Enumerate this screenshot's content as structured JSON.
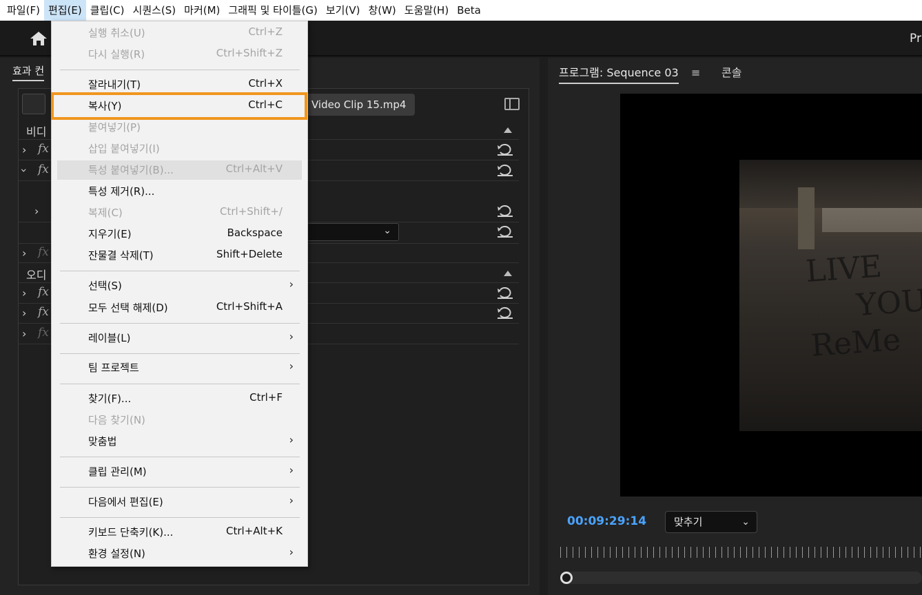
{
  "menubar": {
    "items": [
      "파일(F)",
      "편집(E)",
      "클립(C)",
      "시퀀스(S)",
      "마커(M)",
      "그래픽 및 타이틀(G)",
      "보기(V)",
      "창(W)",
      "도움말(H)",
      "Beta"
    ]
  },
  "app": {
    "title_fragment": "Pr"
  },
  "left_panel": {
    "tab": "효과 컨",
    "clip_name": "Video Clip 15.mp4",
    "video_section": "비디",
    "audio_section": "오디",
    "fx_label": "fx"
  },
  "right_panel": {
    "program_tab": "프로그램: Sequence 03",
    "menu_icon": "≡",
    "console_tab": "콘솔",
    "timecode": "00:09:29:14",
    "fit_label": "맞추기",
    "graffiti_lines": [
      "LIVE",
      "YOU",
      "ReMe"
    ]
  },
  "edit_menu": {
    "items": [
      {
        "label": "실행 취소(U)",
        "shortcut": "Ctrl+Z",
        "disabled": true
      },
      {
        "label": "다시 실행(R)",
        "shortcut": "Ctrl+Shift+Z",
        "disabled": true
      },
      {
        "label": "잘라내기(T)",
        "shortcut": "Ctrl+X",
        "disabled": false
      },
      {
        "label": "복사(Y)",
        "shortcut": "Ctrl+C",
        "disabled": false
      },
      {
        "label": "붙여넣기(P)",
        "shortcut": "",
        "disabled": true
      },
      {
        "label": "삽입 붙여넣기(I)",
        "shortcut": "",
        "disabled": true
      },
      {
        "label": "특성 붙여넣기(B)...",
        "shortcut": "Ctrl+Alt+V",
        "disabled": true
      },
      {
        "label": "특성 제거(R)...",
        "shortcut": "",
        "disabled": false
      },
      {
        "label": "복제(C)",
        "shortcut": "Ctrl+Shift+/",
        "disabled": true
      },
      {
        "label": "지우기(E)",
        "shortcut": "Backspace",
        "disabled": false
      },
      {
        "label": "잔물결 삭제(T)",
        "shortcut": "Shift+Delete",
        "disabled": false
      },
      {
        "label": "선택(S)",
        "shortcut": "",
        "disabled": false
      },
      {
        "label": "모두 선택 해제(D)",
        "shortcut": "Ctrl+Shift+A",
        "disabled": false
      },
      {
        "label": "레이블(L)",
        "shortcut": "",
        "disabled": false
      },
      {
        "label": "팀 프로젝트",
        "shortcut": "",
        "disabled": false
      },
      {
        "label": "찾기(F)...",
        "shortcut": "Ctrl+F",
        "disabled": false
      },
      {
        "label": "다음 찾기(N)",
        "shortcut": "",
        "disabled": true
      },
      {
        "label": "맞춤법",
        "shortcut": "",
        "disabled": false
      },
      {
        "label": "클립 관리(M)",
        "shortcut": "",
        "disabled": false
      },
      {
        "label": "다음에서 편집(E)",
        "shortcut": "",
        "disabled": false
      },
      {
        "label": "키보드 단축키(K)...",
        "shortcut": "Ctrl+Alt+K",
        "disabled": false
      },
      {
        "label": "환경 설정(N)",
        "shortcut": "",
        "disabled": false
      }
    ],
    "submenu_arrow": "›"
  },
  "colors": {
    "highlight": "#f0961e",
    "timecode": "#4aa3ff"
  }
}
